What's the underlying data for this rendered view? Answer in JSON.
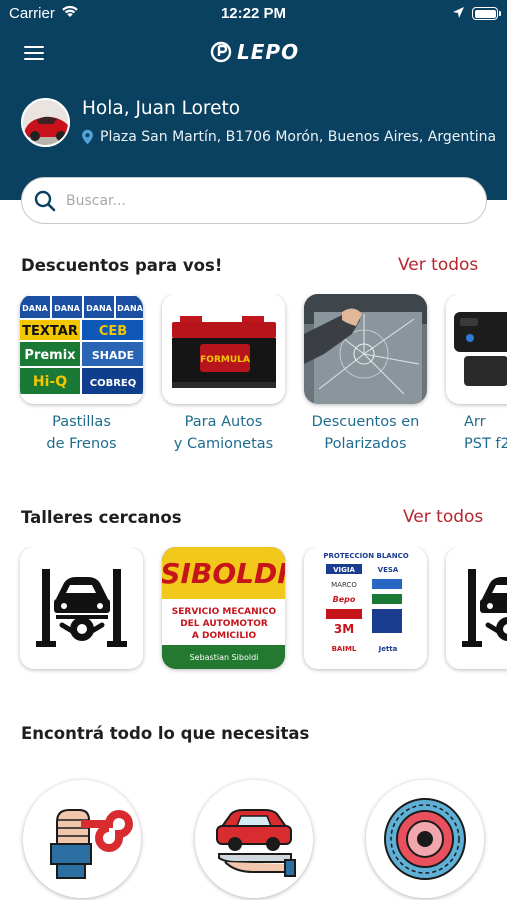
{
  "status_bar": {
    "carrier": "Carrier",
    "time": "12:22 PM",
    "battery_level": 1.0
  },
  "header": {
    "brand": "LEPO",
    "greeting": "Hola, Juan Loreto",
    "address": "Plaza San Martín, B1706 Morón, Buenos Aires, Argentina"
  },
  "search": {
    "placeholder": "Buscar..."
  },
  "discounts": {
    "title": "Descuentos para vos!",
    "see_all": "Ver todos",
    "items": [
      {
        "label": "Pastillas\nde Frenos",
        "image": "brake-pads-brands-image"
      },
      {
        "label": "Para Autos\ny Camionetas",
        "image": "car-battery-image"
      },
      {
        "label": "Descuentos en\nPolarizados",
        "image": "broken-window-image"
      },
      {
        "label": "Arr\nPST f2",
        "image": "car-alarm-image"
      }
    ]
  },
  "workshops": {
    "title": "Talleres cercanos",
    "see_all": "Ver todos",
    "items": [
      {
        "name": "car-lift-icon"
      },
      {
        "name": "siboldi-workshop-image",
        "text": [
          "SIBOLDI",
          "SERVICIO MECANICO",
          "DEL AUTOMOTOR",
          "A DOMICILIO",
          "Sebastian Siboldi"
        ]
      },
      {
        "name": "proteccion-blanco-image",
        "text": [
          "PROTECCION BLANCO",
          "VIGIA",
          "VESA",
          "MARCO",
          "Bepo",
          "3M",
          "BAIML",
          "Jetta"
        ]
      },
      {
        "name": "car-lift-icon"
      }
    ]
  },
  "categories": {
    "title": "Encontrá todo lo que necesitas",
    "items": [
      {
        "name": "repair-hand-icon"
      },
      {
        "name": "car-service-hand-icon"
      },
      {
        "name": "tire-icon"
      }
    ]
  },
  "brake_brands": [
    "DANA",
    "TEXTAR",
    "CEB",
    "Premix",
    "SHADE",
    "Hi-Q",
    "COBREQ"
  ],
  "battery_brand": "FORMULA",
  "colors": {
    "header": "#0b4160",
    "accent": "#b5262d",
    "label": "#1f6d8e"
  }
}
